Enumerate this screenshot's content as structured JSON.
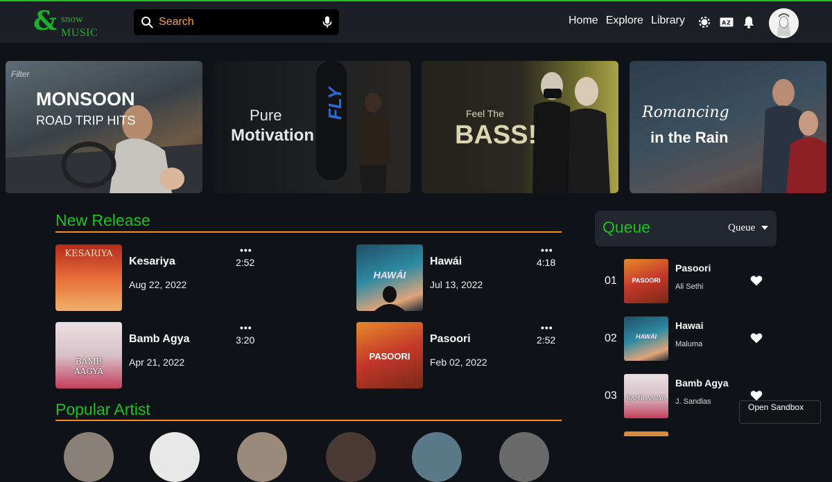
{
  "logo": {
    "mark": "&",
    "top": "snow",
    "bottom": "MUSIC"
  },
  "search": {
    "placeholder": "Search",
    "icon": "search-icon",
    "mic": "mic-icon"
  },
  "nav": {
    "home": "Home",
    "explore": "Explore",
    "library": "Library"
  },
  "header_icons": [
    "brightness-icon",
    "translate-icon",
    "bell-icon",
    "avatar"
  ],
  "banners": [
    {
      "line1": "MONSOON",
      "line2": "ROAD TRIP HITS",
      "corner": "Filter"
    },
    {
      "line1": "Pure",
      "line2": "Motivation",
      "side": "FLY"
    },
    {
      "line1": "Feel The",
      "line2": "BASS!"
    },
    {
      "line1": "Romancing",
      "line2": "in the Rain"
    }
  ],
  "new_release": {
    "title": "New Release",
    "songs": [
      {
        "name": "Kesariya",
        "date": "Aug 22, 2022",
        "duration": "2:52",
        "menu": "•••",
        "art": "KESARIYA"
      },
      {
        "name": "Hawái",
        "date": "Jul 13, 2022",
        "duration": "4:18",
        "menu": "•••",
        "art": "HAWÁI"
      },
      {
        "name": "Bamb Agya",
        "date": "Apr 21, 2022",
        "duration": "3:20",
        "menu": "•••",
        "art": "BAMB AAGYA"
      },
      {
        "name": "Pasoori",
        "date": "Feb 02, 2022",
        "duration": "2:52",
        "menu": "•••",
        "art": "PASOORI"
      }
    ]
  },
  "popular_artist": {
    "title": "Popular Artist"
  },
  "queue": {
    "title": "Queue",
    "select_label": "Queue",
    "items": [
      {
        "num": "01",
        "name": "Pasoori",
        "artist": "Ali Sethi",
        "art": "PASOORI"
      },
      {
        "num": "02",
        "name": "Hawai",
        "artist": "Maluma",
        "art": "HAWÁI"
      },
      {
        "num": "03",
        "name": "Bamb Agya",
        "artist": "J. Sandlas",
        "art": "BAMB AAGYA"
      }
    ]
  },
  "sandbox": {
    "label": "Open Sandbox"
  },
  "colors": {
    "accent_green": "#19c21f",
    "accent_orange": "#ff8c1a",
    "search_text": "#ff9a2f",
    "background": "#0f1217",
    "header": "#1c1f26"
  }
}
